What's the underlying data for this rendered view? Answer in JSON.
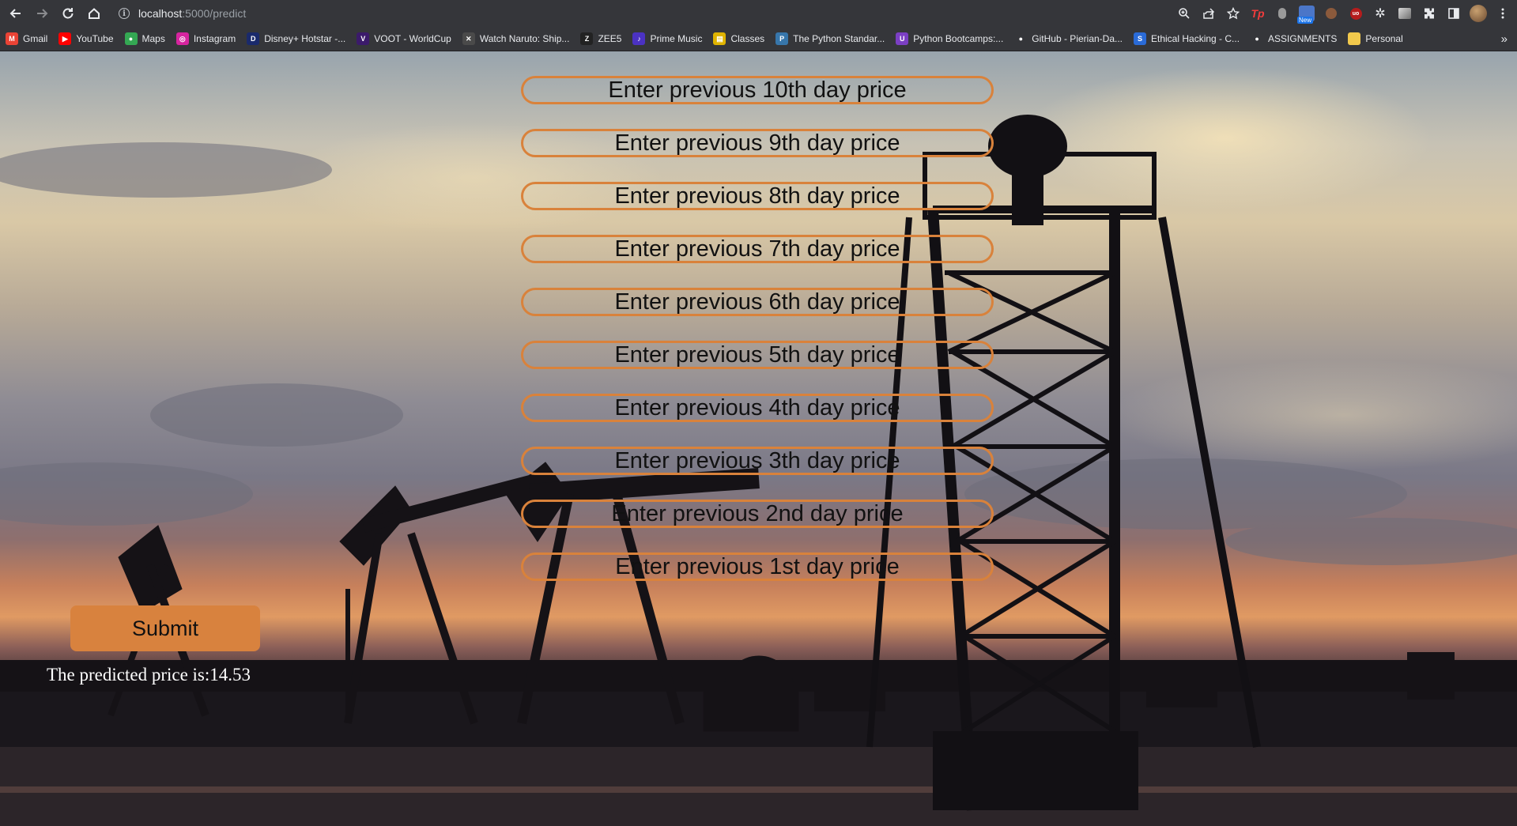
{
  "browser": {
    "url_host": "localhost",
    "url_path": ":5000/predict",
    "bookmarks": [
      {
        "label": "Gmail",
        "icon": "gmail-icon",
        "color": "#ea4335",
        "glyph": "M"
      },
      {
        "label": "YouTube",
        "icon": "youtube-icon",
        "color": "#ff0000",
        "glyph": "▶"
      },
      {
        "label": "Maps",
        "icon": "maps-icon",
        "color": "#34a853",
        "glyph": "●"
      },
      {
        "label": "Instagram",
        "icon": "instagram-icon",
        "color": "#d6249f",
        "glyph": "◎"
      },
      {
        "label": "Disney+ Hotstar -...",
        "icon": "hotstar-icon",
        "color": "#1a2a6c",
        "glyph": "D"
      },
      {
        "label": "VOOT - WorldCup",
        "icon": "voot-icon",
        "color": "#3b1a6b",
        "glyph": "V"
      },
      {
        "label": "Watch Naruto: Ship...",
        "icon": "naruto-icon",
        "color": "#4a4a4a",
        "glyph": "✕"
      },
      {
        "label": "ZEE5",
        "icon": "zee5-icon",
        "color": "#222222",
        "glyph": "Z"
      },
      {
        "label": "Prime Music",
        "icon": "prime-music-icon",
        "color": "#4b32c3",
        "glyph": "♪"
      },
      {
        "label": "Classes",
        "icon": "classes-icon",
        "color": "#e0b400",
        "glyph": "▤"
      },
      {
        "label": "The Python Standar...",
        "icon": "python-icon",
        "color": "#3776ab",
        "glyph": "P"
      },
      {
        "label": "Python Bootcamps:...",
        "icon": "bootcamp-icon",
        "color": "#7b3fc4",
        "glyph": "U"
      },
      {
        "label": "GitHub - Pierian-Da...",
        "icon": "github-icon",
        "color": "#35363a",
        "glyph": "●"
      },
      {
        "label": "Ethical Hacking - C...",
        "icon": "ethical-hacking-icon",
        "color": "#2a6bd8",
        "glyph": "S"
      },
      {
        "label": "ASSIGNMENTS",
        "icon": "github-icon",
        "color": "#35363a",
        "glyph": "●"
      },
      {
        "label": "Personal",
        "icon": "folder-icon",
        "color": "#f2c94c",
        "glyph": ""
      }
    ]
  },
  "form": {
    "inputs": [
      {
        "placeholder": "Enter previous 10th day price"
      },
      {
        "placeholder": "Enter previous 9th day price"
      },
      {
        "placeholder": "Enter previous 8th day price"
      },
      {
        "placeholder": "Enter previous 7th day price"
      },
      {
        "placeholder": "Enter previous 6th day price"
      },
      {
        "placeholder": "Enter previous 5th day price"
      },
      {
        "placeholder": "Enter previous 4th day price"
      },
      {
        "placeholder": "Enter previous 3th day price"
      },
      {
        "placeholder": "Enter previous 2nd day price"
      },
      {
        "placeholder": "Enter previous 1st day price"
      }
    ],
    "submit_label": "Submit",
    "result_text": "The predicted price is:14.53"
  },
  "colors": {
    "accent": "#d8823e",
    "input_border": "#d9823b",
    "result_text": "#ffffff"
  }
}
